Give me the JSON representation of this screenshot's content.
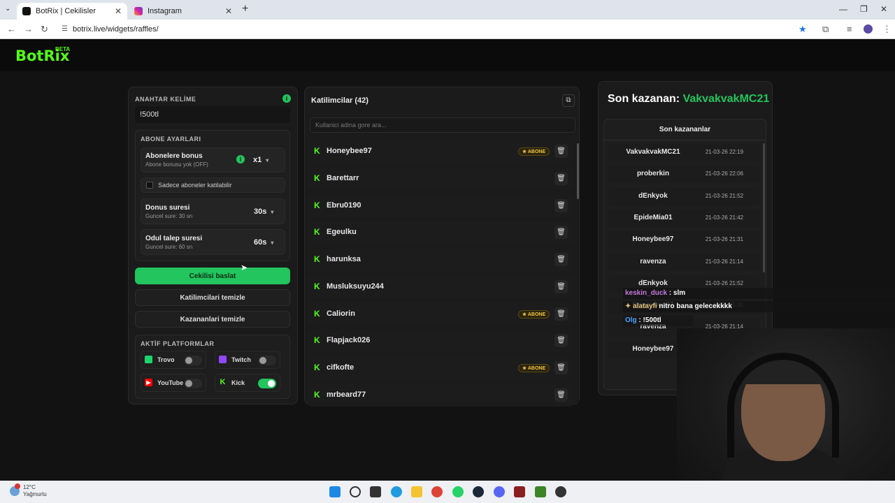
{
  "browser": {
    "tabs": [
      {
        "title": "BotRix | Cekilisler",
        "active": true
      },
      {
        "title": "Instagram",
        "active": false
      }
    ],
    "url": "botrix.live/widgets/raffles/"
  },
  "brand": {
    "name": "BotRix",
    "badge": "BETA",
    "accent": "#53fc18"
  },
  "settings": {
    "keyword_label": "ANAHTAR KELİME",
    "keyword_value": "!500tl",
    "sub_settings_label": "ABONE AYARLARI",
    "sub_bonus": {
      "title": "Abonelere bonus",
      "subtitle": "Abone bonusu yok (OFF)",
      "value": "x1"
    },
    "sub_only_label": "Sadece aboneler katilabilir",
    "duration": {
      "title": "Donus suresi",
      "subtitle": "Guncel sure: 30 sn",
      "value": "30s"
    },
    "claim": {
      "title": "Odul talep suresi",
      "subtitle": "Guncel sure: 60 sn",
      "value": "60s"
    },
    "start_button": "Cekilisi baslat",
    "clear_participants_button": "Katilimcilari temizle",
    "clear_winners_button": "Kazananlari temizle",
    "platforms_label": "AKTİF PLATFORMLAR",
    "platforms": [
      {
        "name": "Trovo",
        "enabled": false
      },
      {
        "name": "Twitch",
        "enabled": false
      },
      {
        "name": "YouTube",
        "enabled": false
      },
      {
        "name": "Kick",
        "enabled": true
      }
    ]
  },
  "participants": {
    "title": "Katilimcilar (42)",
    "search_placeholder": "Kullanici adina gore ara...",
    "items": [
      {
        "name": "Honeybee97",
        "badge": "ABONE"
      },
      {
        "name": "Barettarr",
        "badge": ""
      },
      {
        "name": "Ebru0190",
        "badge": ""
      },
      {
        "name": "Egeulku",
        "badge": ""
      },
      {
        "name": "harunksa",
        "badge": ""
      },
      {
        "name": "Musluksuyu244",
        "badge": ""
      },
      {
        "name": "Caliorin",
        "badge": "ABONE"
      },
      {
        "name": "Flapjack026",
        "badge": ""
      },
      {
        "name": "cifkofte",
        "badge": "ABONE"
      },
      {
        "name": "mrbeard77",
        "badge": ""
      }
    ]
  },
  "winners": {
    "last_winner_label": "Son kazanan:",
    "last_winner_name": "VakvakvakMC21",
    "list_title": "Son kazananlar",
    "items": [
      {
        "name": "VakvakvakMC21",
        "time": "21-03-26 22:19"
      },
      {
        "name": "proberkin",
        "time": "21-03-26 22:06"
      },
      {
        "name": "dEnkyok",
        "time": "21-03-26 21:52"
      },
      {
        "name": "EpideMia01",
        "time": "21-03-26 21:42"
      },
      {
        "name": "Honeybee97",
        "time": "21-03-26 21:31"
      },
      {
        "name": "ravenza",
        "time": "21-03-26 21:14"
      },
      {
        "name": "dEnkyok",
        "time": "21-03-26 21:52"
      },
      {
        "name": "Honeybee97",
        "time": "21-03-26 21:31"
      },
      {
        "name": "ravenza",
        "time": "21-03-26 21:14"
      },
      {
        "name": "Honeybee97",
        "time": "21-03-26 21:31"
      }
    ]
  },
  "chat": [
    {
      "user": "keskin_duck",
      "message": ": slm"
    },
    {
      "user": "alatayfi",
      "message": "nitro bana gelecekkkk"
    },
    {
      "user": "Olg",
      "message": ": !500tl"
    }
  ],
  "taskbar": {
    "temperature": "12°C",
    "weather": "Yağmurlu"
  }
}
